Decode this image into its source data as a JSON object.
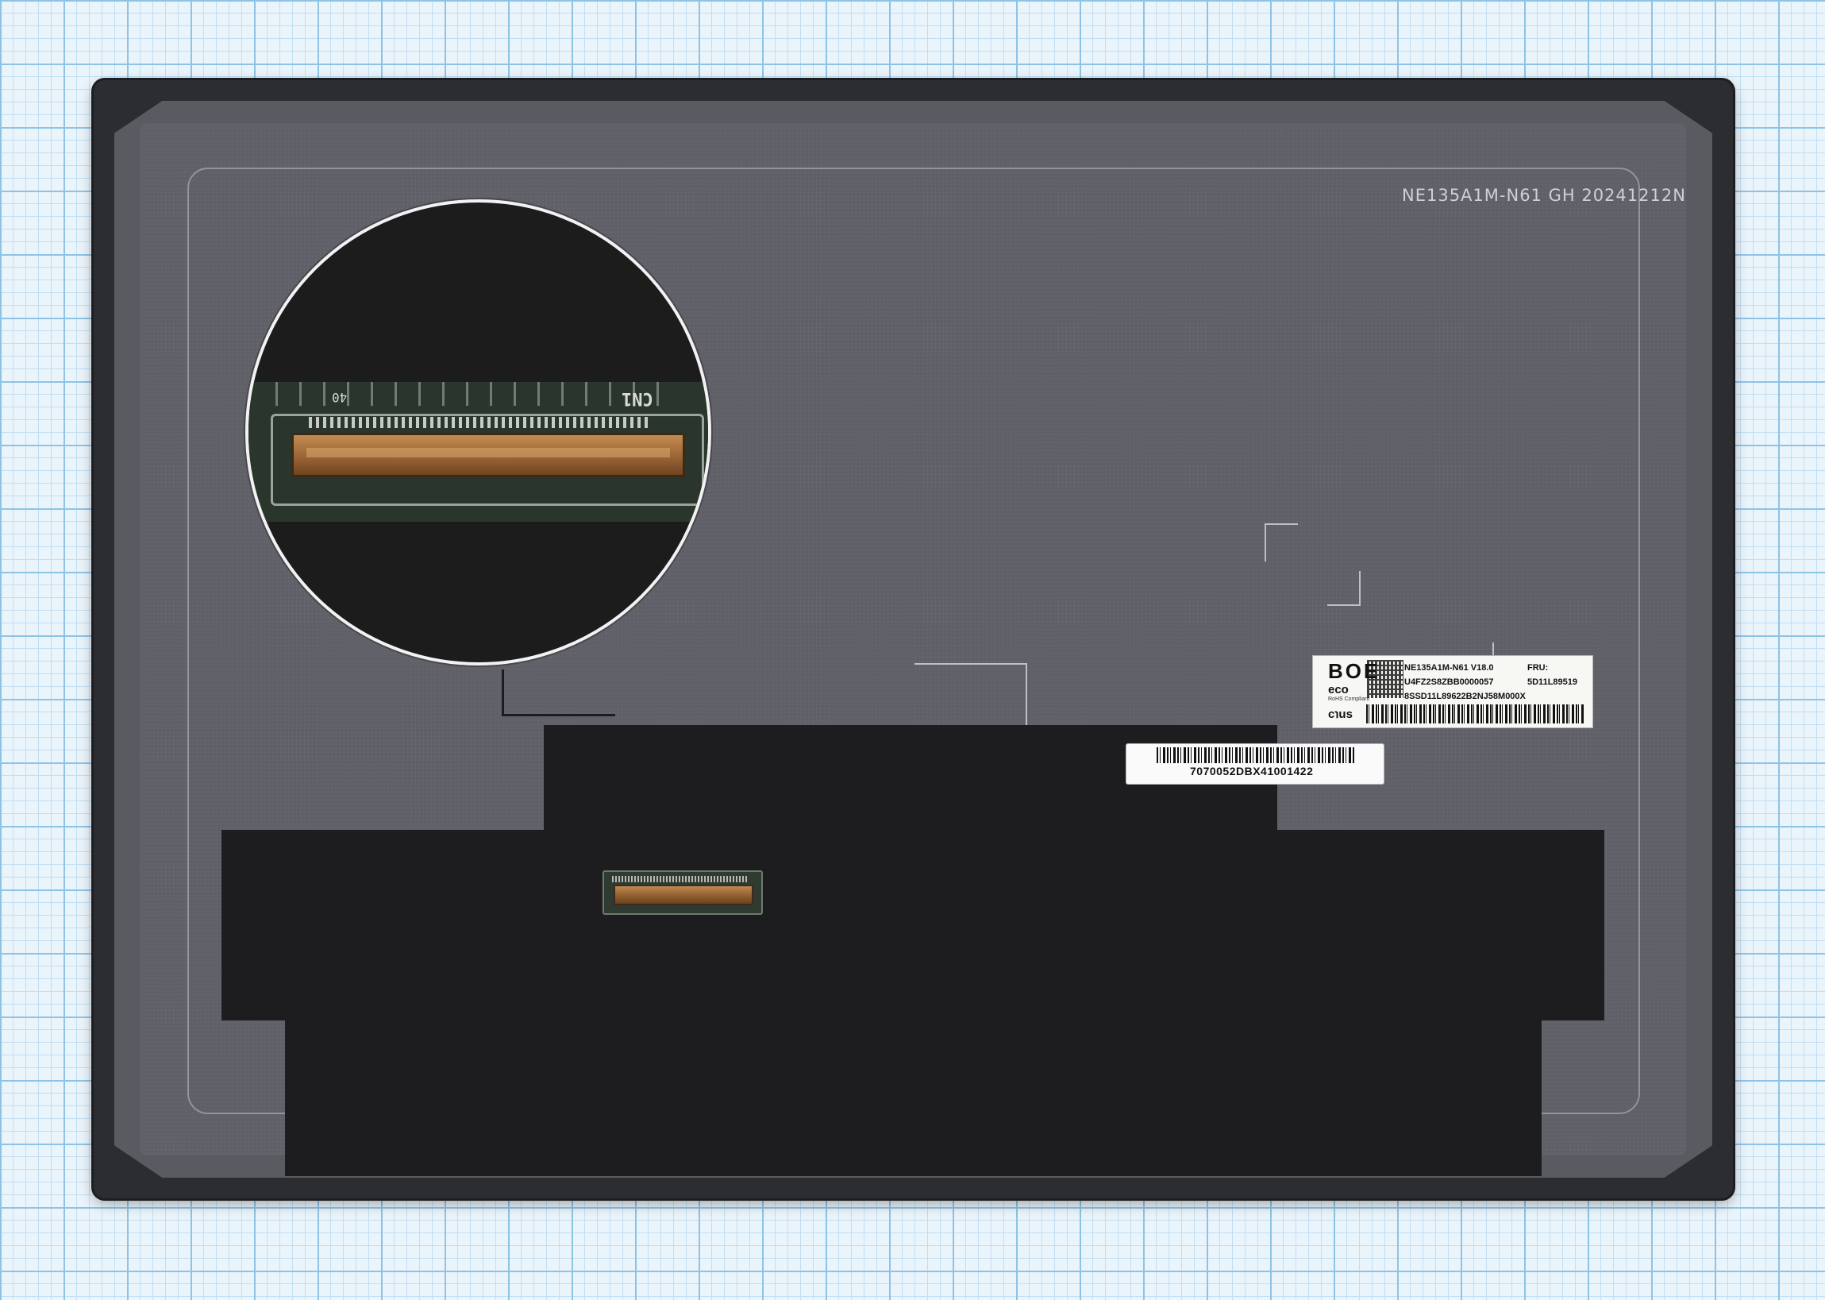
{
  "panel": {
    "model_stamp": "NE135A1M-N61 GH 20241212N"
  },
  "zoom_inset": {
    "connector_label": "CN1",
    "pin_label": "40"
  },
  "product_label": {
    "logo": "BOE",
    "eco_mark": "eco",
    "rohs_text": "RoHS Compliant",
    "ul_mark": "c℩us",
    "line1": "NE135A1M-N61   V18.0",
    "fru_label": "FRU:",
    "line2": "U4FZ2S8ZBB0000057",
    "fru_number": "5D11L89519",
    "line3": "8SSD11L89622B2NJ58M000X"
  },
  "barcode_label": {
    "text": "7070052DBX41001422"
  }
}
